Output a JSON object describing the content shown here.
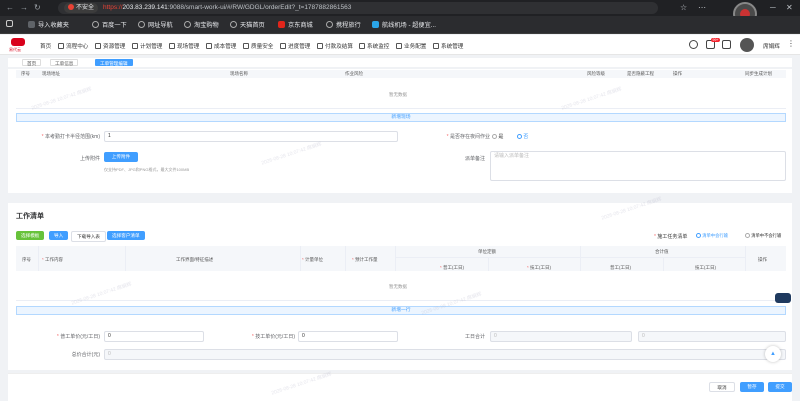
{
  "browser": {
    "insecure_label": "不安全",
    "url_scheme": "https://",
    "url_host": "203.83.239.141",
    "url_rest": ":9088/smart-work-ui/#/RW/GDGL/orderEdit?_t=1787882861563",
    "bookmarks": [
      "导入收藏夹",
      "百度一下",
      "网址导航",
      "淘宝购物",
      "天猫首页",
      "京东商城",
      "携程旅行",
      "航线机场 - 超便宜..."
    ]
  },
  "app": {
    "logo_text": "易代云",
    "menu": [
      "首页",
      "流程中心",
      "资源管理",
      "计划管理",
      "现场管理",
      "成本管理",
      "质量安全",
      "进度管理",
      "付款及结算",
      "系统监控",
      "业务配置",
      "系统管理"
    ],
    "notification_count": "99+",
    "user_name": "席娟辉"
  },
  "page_tabs": [
    "首页",
    "工单信息",
    "工单管理编辑"
  ],
  "risk_table": {
    "headers": [
      "序号",
      "现场地址",
      "现场名称",
      "作业风险",
      "风险等级",
      "是否隐蔽工程",
      "操作",
      "同步生成计划"
    ],
    "empty_text": "暂无数据",
    "add_label": "新增现场"
  },
  "form": {
    "radius_label": "本考勤打卡半径范围(km)",
    "radius_value": "1",
    "night_label": "是否存在夜间作业",
    "night_yes": "是",
    "night_no": "否",
    "attach_label": "上传附件",
    "upload_button": "上传附件",
    "upload_hint": "仅支持PDF、JPG和PNG格式，最大文件100MB",
    "remark_label": "派单备注",
    "remark_placeholder": "请输入派单备注"
  },
  "work_list": {
    "title": "工作清单",
    "buttons": [
      "选择模板",
      "导入",
      "下载导入表",
      "选择客户清单"
    ],
    "task_label": "施工任务清单",
    "task_opt1": "清单中会行输",
    "task_opt2": "清单中不会行输",
    "headers": [
      "序号",
      "工作内容",
      "工作界面/特征描述",
      "计量单位",
      "预计工作量",
      "单位定额",
      "合计值",
      "操作"
    ],
    "sub_headers": [
      "普工(工日)",
      "技工(工日)",
      "普工(工日)",
      "技工(工日)"
    ],
    "empty_text": "暂无数据",
    "add_label": "新增一行"
  },
  "totals": {
    "common_price_label": "普工单价(元/工日)",
    "common_price_value": "0",
    "tech_price_label": "技工单价(元/工日)",
    "tech_price_value": "0",
    "work_total_label": "工日合计",
    "work_total_a": "0",
    "work_total_b": "0",
    "grand_total_label": "总价合计(元)",
    "grand_total_value": "0"
  },
  "footer": {
    "cancel": "取消",
    "save": "暂存",
    "submit": "提交"
  },
  "watermark": "2026-08-28 10:07:42 席娟辉",
  "colors": {
    "primary": "#409eff",
    "green": "#67c23a",
    "danger": "#f56c6c"
  }
}
